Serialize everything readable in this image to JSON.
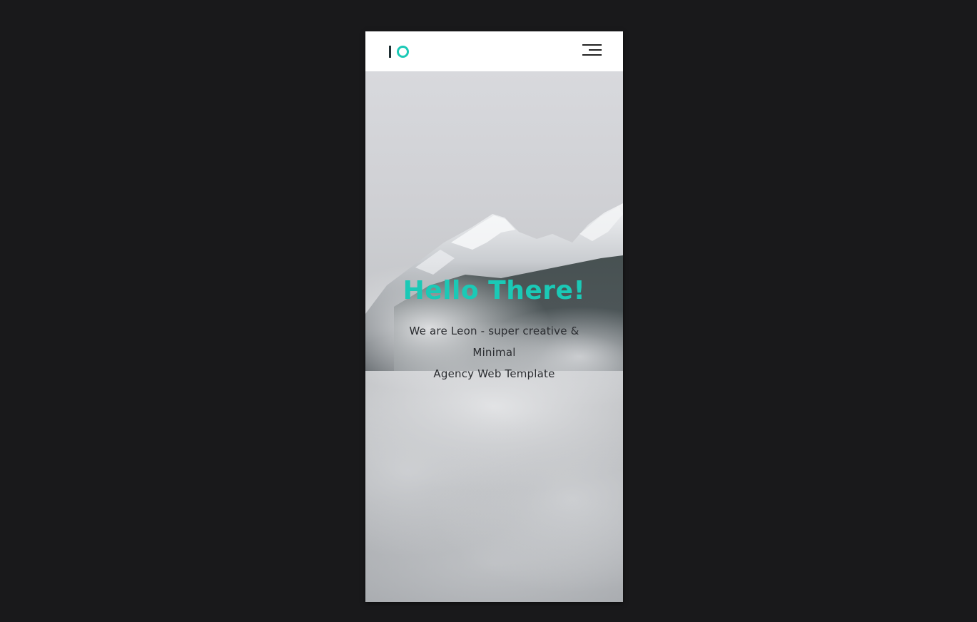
{
  "brand": {
    "logo_icon": "io-logo-icon",
    "accent_color": "#1bc9b6",
    "dark_color": "#1f2f33"
  },
  "nav": {
    "menu_icon": "hamburger-menu-icon"
  },
  "hero": {
    "title": "Hello There!",
    "subtitle_line1": "We are Leon - super creative &",
    "subtitle_line2": "Minimal",
    "subtitle_line3": "Agency Web Template",
    "background": "misty-snowy-mountain-photo"
  }
}
